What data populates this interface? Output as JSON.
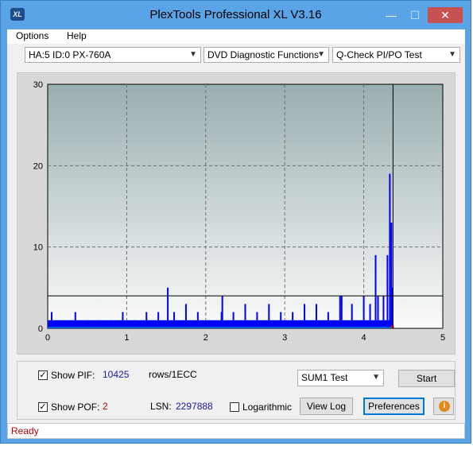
{
  "window": {
    "title": "PlexTools Professional XL V3.16",
    "icon": "XL",
    "min_glyph": "—",
    "max_glyph": "☐",
    "close_glyph": "✕"
  },
  "menu": {
    "items": [
      "Options",
      "Help"
    ]
  },
  "toolbar": {
    "drive": "HA:5 ID:0  PX-760A",
    "function": "DVD Diagnostic Functions",
    "test": "Q-Check PI/PO Test"
  },
  "chart_data": {
    "type": "bar",
    "title": "",
    "xlabel": "",
    "ylabel": "",
    "xlim": [
      0,
      5
    ],
    "ylim": [
      0,
      30
    ],
    "x_ticks": [
      "0",
      "1",
      "2",
      "3",
      "4",
      "5"
    ],
    "y_ticks": [
      "0",
      "10",
      "20",
      "30"
    ],
    "threshold": 4,
    "end_marker_x": 4.37,
    "colors": {
      "bars": "#0000ff",
      "threshold": "#000000",
      "baseline": "#00c0c0",
      "grid": "#707070",
      "po": "#ff0000"
    },
    "series": [
      {
        "name": "PIF",
        "x": [
          0.05,
          0.2,
          0.35,
          0.5,
          0.65,
          0.8,
          0.95,
          1.1,
          1.25,
          1.4,
          1.52,
          1.6,
          1.75,
          1.9,
          2.05,
          2.2,
          2.21,
          2.35,
          2.5,
          2.65,
          2.8,
          2.95,
          3.1,
          3.25,
          3.4,
          3.55,
          3.7,
          3.72,
          3.85,
          4.0,
          4.08,
          4.15,
          4.18,
          4.25,
          4.3,
          4.33,
          4.35,
          4.36
        ],
        "values": [
          2,
          1,
          2,
          1,
          1,
          1,
          2,
          1,
          2,
          2,
          5,
          2,
          3,
          2,
          1,
          2,
          4,
          2,
          3,
          2,
          3,
          2,
          2,
          3,
          3,
          2,
          4,
          4,
          3,
          4,
          3,
          9,
          4,
          4,
          9,
          19,
          13,
          5
        ]
      }
    ]
  },
  "controls": {
    "show_pif_label": "Show PIF:",
    "pif_value": "10425",
    "pif_unit": "rows/1ECC",
    "show_pof_label": "Show POF:",
    "pof_value": "2",
    "lsn_label": "LSN:",
    "lsn_value": "2297888",
    "logarithmic_label": "Logarithmic",
    "sum_select": "SUM1 Test",
    "start_label": "Start",
    "viewlog_label": "View Log",
    "preferences_label": "Preferences",
    "info_glyph": "i",
    "show_pif_checked": true,
    "show_pof_checked": true,
    "logarithmic_checked": false
  },
  "status": {
    "text": "Ready"
  }
}
